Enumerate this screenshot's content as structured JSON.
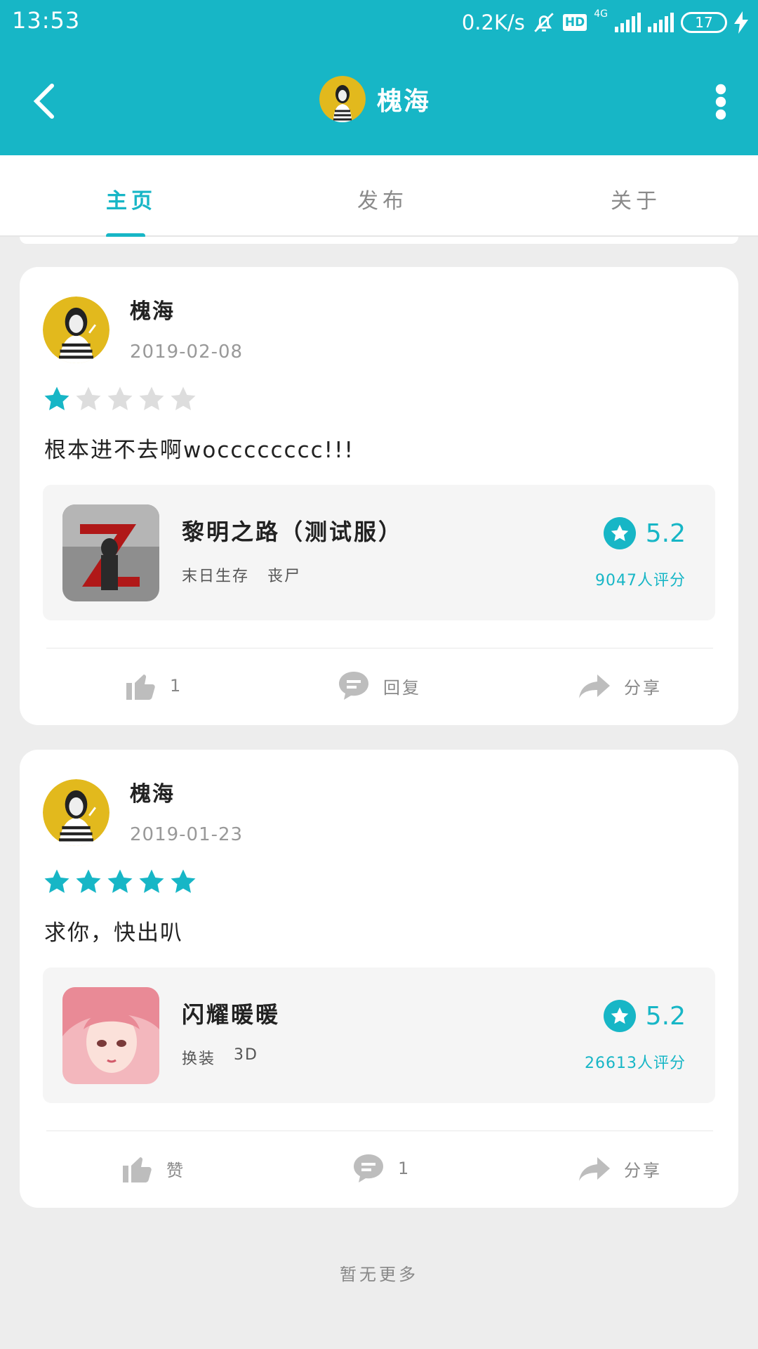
{
  "status_bar": {
    "time": "13:53",
    "net_speed": "0.2K/s",
    "hd_badge": "HD",
    "network": "4G",
    "battery": "17"
  },
  "header": {
    "title": "槐海"
  },
  "tabs": [
    {
      "label": "主页",
      "active": true
    },
    {
      "label": "发布",
      "active": false
    },
    {
      "label": "关于",
      "active": false
    }
  ],
  "posts": [
    {
      "user": "槐海",
      "date": "2019-02-08",
      "stars": 1,
      "comment": "根本进不去啊wocccccccc!!!",
      "game": {
        "name": "黎明之路（测试服）",
        "tags": [
          "末日生存",
          "丧尸"
        ],
        "score": "5.2",
        "rating_count": "9047人评分"
      },
      "actions": {
        "like": "1",
        "reply": "回复",
        "share": "分享"
      }
    },
    {
      "user": "槐海",
      "date": "2019-01-23",
      "stars": 5,
      "comment": "求你，快出叭",
      "game": {
        "name": "闪耀暖暖",
        "tags": [
          "换装",
          "3D"
        ],
        "score": "5.2",
        "rating_count": "26613人评分"
      },
      "actions": {
        "like": "赞",
        "reply": "1",
        "share": "分享"
      }
    }
  ],
  "footer": {
    "no_more": "暂无更多"
  },
  "colors": {
    "accent": "#17b6c6",
    "star_off": "#dddddd",
    "icon_gray": "#bdbdbd"
  }
}
